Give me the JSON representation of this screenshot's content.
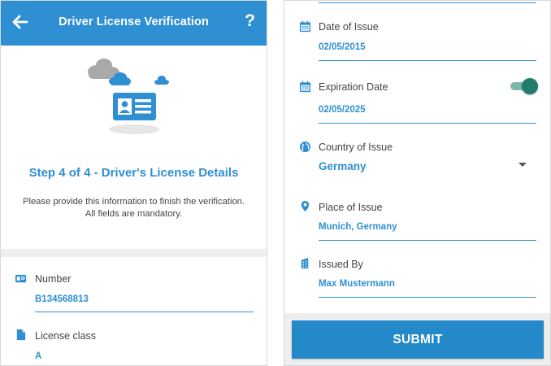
{
  "header": {
    "title": "Driver License Verification",
    "back_icon": "arrow-left-icon",
    "help_label": "?"
  },
  "illustration": {
    "icon": "id-card-with-clouds-illustration"
  },
  "intro": {
    "step_title": "Step 4 of 4 - Driver's License Details",
    "description_line1": "Please provide this information to finish the verification.",
    "description_line2": "All fields are mandatory."
  },
  "fields_left": {
    "number": {
      "label": "Number",
      "value": "B134568813",
      "icon": "id-card-icon"
    },
    "license_class": {
      "label": "License class",
      "value": "A",
      "icon": "document-icon"
    }
  },
  "fields_right": {
    "date_of_issue": {
      "label": "Date of Issue",
      "value": "02/05/2015",
      "icon": "calendar-icon"
    },
    "expiration_date": {
      "label": "Expiration Date",
      "value": "02/05/2025",
      "icon": "calendar-icon",
      "toggle_on": true
    },
    "country_of_issue": {
      "label": "Country of Issue",
      "value": "Germany",
      "icon": "globe-icon"
    },
    "place_of_issue": {
      "label": "Place of Issue",
      "value": "Munich, Germany",
      "icon": "map-pin-icon"
    },
    "issued_by": {
      "label": "Issued By",
      "value": "Max Mustermann",
      "icon": "building-icon"
    }
  },
  "actions": {
    "submit_label": "SUBMIT"
  },
  "colors": {
    "primary": "#2f8fd3",
    "toggle": "#1e7d6c",
    "background_band": "#eeeeee"
  }
}
